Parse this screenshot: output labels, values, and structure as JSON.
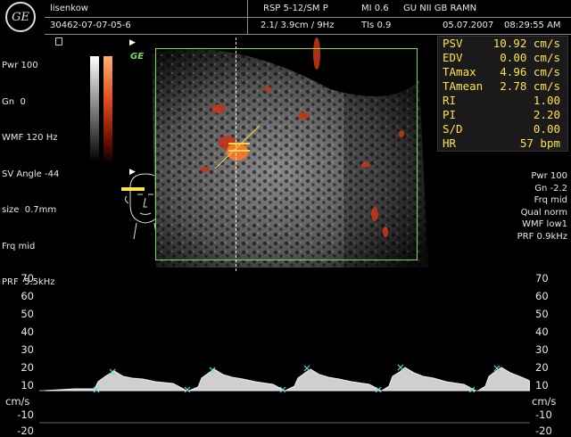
{
  "header": {
    "patient_name": "lisenkow",
    "patient_id": "30462-07-07-05-6",
    "probe": "RSP 5-12/SM P",
    "depth_freq": "2.1/ 3.9cm / 9Hz",
    "mi": "MI  0.6",
    "tis": "TIs  0.9",
    "institution": "GU NII GB RAMN",
    "date": "05.07.2007",
    "time": "08:29:55 AM",
    "logo_text": "GE"
  },
  "left_params": [
    "Pwr 100",
    "Gn  0",
    "WMF 120 Hz",
    "SV Angle -44",
    "size  0.7mm",
    "Frq mid",
    "PRF  5.5kHz"
  ],
  "right_params": [
    "Pwr 100",
    "Gn -2.2",
    "Frq mid",
    "Qual norm",
    "WMF low1",
    "PRF  0.9kHz"
  ],
  "image_marker": "GE",
  "measurements": [
    {
      "label": "PSV",
      "value": "10.92 cm/s"
    },
    {
      "label": "EDV",
      "value": "0.00 cm/s"
    },
    {
      "label": "TAmax",
      "value": "4.96 cm/s"
    },
    {
      "label": "TAmean",
      "value": "2.78 cm/s"
    },
    {
      "label": "RI",
      "value": "1.00"
    },
    {
      "label": "PI",
      "value": "2.20"
    },
    {
      "label": "S/D",
      "value": "0.00"
    },
    {
      "label": "HR",
      "value": "57 bpm"
    }
  ],
  "scale": {
    "ticks": [
      "70",
      "60",
      "50",
      "40",
      "30",
      "20",
      "10",
      "-10",
      "-20"
    ],
    "unit": "cm/s"
  },
  "colors": {
    "measure_text": "#ffe24a",
    "roi_box": "#7ed957",
    "caliper": "#f5d742",
    "trace": "#5ee0e0"
  }
}
